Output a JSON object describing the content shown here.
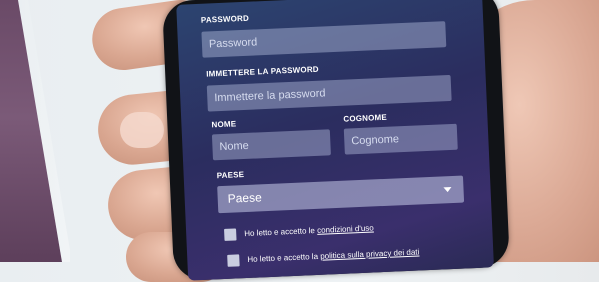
{
  "form": {
    "password_label": "PASSWORD",
    "password_placeholder": "Password",
    "confirm_label": "IMMETTERE LA PASSWORD",
    "confirm_placeholder": "Immettere la password",
    "name_label": "NOME",
    "name_placeholder": "Nome",
    "surname_label": "COGNOME",
    "surname_placeholder": "Cognome",
    "country_label": "PAESE",
    "country_selected": "Paese",
    "terms_prefix": "Ho letto e accetto le ",
    "terms_link": "condizioni d'uso",
    "privacy_prefix": "Ho letto e accetto la ",
    "privacy_link": "politica sulla privacy dei dati"
  },
  "colors": {
    "screen_bg": "#2b2d5f",
    "field_bg": "#aab4dc",
    "text": "#ffffff"
  }
}
